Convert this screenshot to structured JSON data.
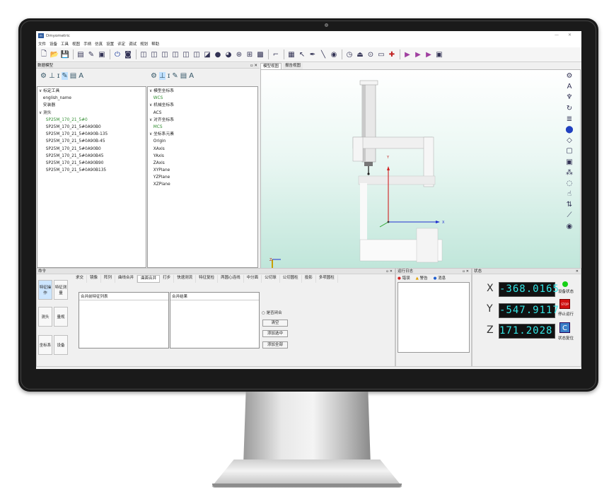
{
  "window": {
    "title": "Dmyometric"
  },
  "menu": [
    "文件",
    "设备",
    "工具",
    "视图",
    "手柄",
    "仿真",
    "设置",
    "评定",
    "调试",
    "规划",
    "帮助"
  ],
  "toolbar_icons": [
    "new-file-icon",
    "open-folder-icon",
    "save-icon",
    "layers-icon",
    "brush-icon",
    "monitor-icon",
    "power-icon",
    "camera-icon",
    "cube-front-icon",
    "cube-back-icon",
    "cube-left-icon",
    "cube-right-icon",
    "cube-top-icon",
    "cube-bottom-icon",
    "cube-iso-icon",
    "sphere-icon",
    "sphere-shade-icon",
    "scan-icon",
    "grid-view-icon",
    "mark-icon",
    "probe-icon",
    "select-box-icon",
    "pointer-icon",
    "pen-icon",
    "line-icon",
    "eye-icon",
    "clock-icon",
    "stack-icon",
    "target-icon",
    "board-icon",
    "pin-icon",
    "play-icon",
    "play2-icon",
    "play3-icon",
    "play4-icon",
    "screen-icon"
  ],
  "left_panel": {
    "header": "数据模型",
    "tree1": [
      "∨ 标定工具",
      "　english_name",
      "　安装器",
      "∨ 测头",
      "　SP25M_170_21_5#0",
      "　SP25M_170_21_5#0A90B0",
      "　SP25M_170_21_5#0A90B-135",
      "　SP25M_170_21_5#0A90B-45",
      "　SP25M_170_21_5#0A90B0",
      "　SP25M_170_21_5#0A90B45",
      "　SP25M_170_21_5#0A90B90",
      "　SP25M_170_21_5#0A90B135"
    ],
    "tree2": [
      "∨ 模型坐标系",
      "　WCS",
      "∨ 机械坐标系",
      "　ACS",
      "∨ 对齐坐标系",
      "　MCS",
      "∨ 坐标系元素",
      "　Origin",
      "　XAxis",
      "　YAxis",
      "　ZAxis",
      "　XYPlane",
      "　YZPlane",
      "　XZPlane"
    ],
    "active_color": "#2e8b2e"
  },
  "view_tabs": [
    "模型视图",
    "报告视图"
  ],
  "viewport": {
    "axis_x": "X",
    "axis_y": "Y",
    "axis_z": "Z"
  },
  "command_panel": {
    "header": "命令",
    "side_buttons": [
      "特征操作",
      "特征测量",
      "测头",
      "量规",
      "坐标系",
      "设备"
    ],
    "tabs": [
      "求交",
      "镜像",
      "阵列",
      "曲线合并",
      "曲面合并",
      "打步",
      "快速测流",
      "特征复检",
      "两圆心连线",
      "中分面",
      "公切球",
      "公切圆柱",
      "投影",
      "多项圆柱"
    ],
    "active_tab_index": 4,
    "left_box_title": "合并前特征列表",
    "right_box_title": "合并结果",
    "radio_label": "是否闭合",
    "btn_clear": "清空",
    "btn_add_selected": "添加选中",
    "btn_add_all": "添加全部"
  },
  "message_panel": {
    "header": "运行日志",
    "tabs": [
      "错误",
      "警告",
      "消息"
    ]
  },
  "status_panel": {
    "header": "状态",
    "x_label": "X",
    "y_label": "Y",
    "z_label": "Z",
    "x_value": "-368.0165",
    "y_value": "-547.9117",
    "z_value": "171.2028",
    "s1_label": "设备状态",
    "s2_label": "停止运行",
    "s3_label": "状态复位",
    "stop_text": "STOP"
  }
}
